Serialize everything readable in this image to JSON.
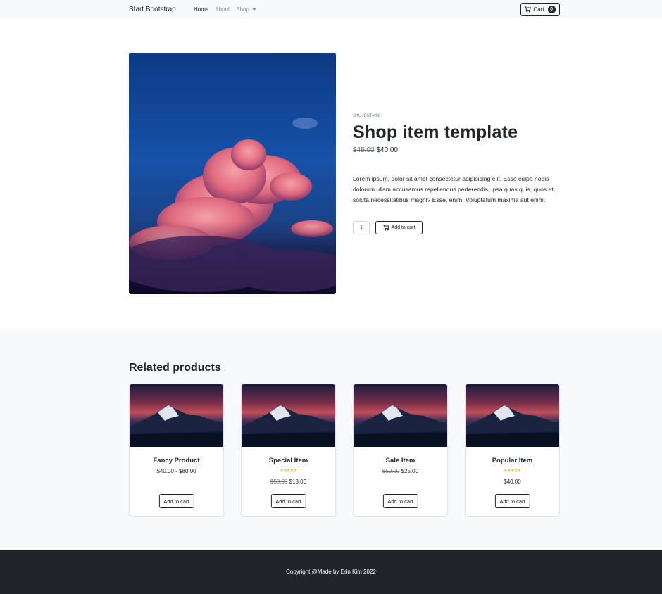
{
  "navbar": {
    "brand": "Start Bootstrap",
    "links": [
      "Home",
      "About",
      "Shop"
    ],
    "cart_label": "Cart",
    "cart_count": "0"
  },
  "product": {
    "sku": "SKU: BST-498",
    "title": "Shop item template",
    "old_price": "$45.00",
    "price": "$40.00",
    "description": "Lorem ipsum, dolor sit amet consectetur adipisicing elit. Esse culpa nobis dolorum ullam accusamus repellendus perferendis, ipsa quas quis, quos et, soluta necessitatibus magni? Esse, enim! Voluptatum maxime aut enim.",
    "quantity": "1",
    "add_label": "Add to cart"
  },
  "related": {
    "title": "Related products",
    "items": [
      {
        "name": "Fancy Product",
        "price": "$40.00 - $80.00",
        "old_price": "",
        "stars": 0,
        "button": "Add to cart"
      },
      {
        "name": "Special Item",
        "price": "$18.00",
        "old_price": "$50.00",
        "stars": 5,
        "button": "Add to cart"
      },
      {
        "name": "Sale Item",
        "price": "$25.00",
        "old_price": "$50.00",
        "stars": 0,
        "button": "Add to cart"
      },
      {
        "name": "Popular Item",
        "price": "$40.00",
        "old_price": "",
        "stars": 5,
        "button": "Add to cart"
      }
    ]
  },
  "footer": {
    "copyright": "Copyright @Made by Erin Kim 2022"
  },
  "colors": {
    "dark": "#212529",
    "light_bg": "#f8f9fa",
    "star": "#ffc107",
    "sky_blue": "#0c3e8c",
    "cloud_pink": "#e8788c"
  }
}
